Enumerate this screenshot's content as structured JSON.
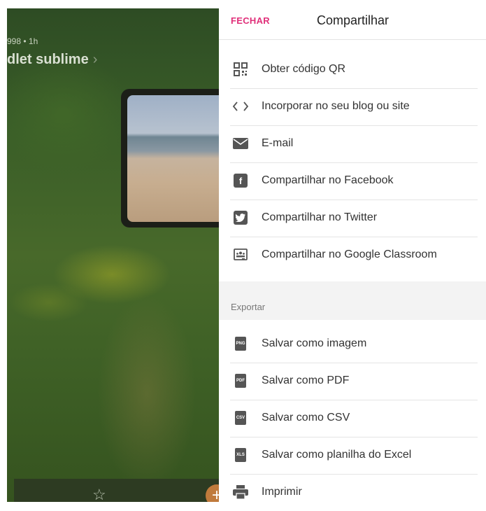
{
  "background": {
    "meta": "998 • 1h",
    "title": "dlet sublime"
  },
  "sheet": {
    "close_label": "FECHAR",
    "title": "Compartilhar",
    "share_items": [
      {
        "label": "Obter código QR",
        "icon": "qr-code-icon"
      },
      {
        "label": "Incorporar no seu blog ou site",
        "icon": "code-icon"
      },
      {
        "label": "E-mail",
        "icon": "envelope-icon"
      },
      {
        "label": "Compartilhar no Facebook",
        "icon": "facebook-icon"
      },
      {
        "label": "Compartilhar no Twitter",
        "icon": "twitter-icon"
      },
      {
        "label": "Compartilhar no Google Classroom",
        "icon": "google-classroom-icon"
      }
    ],
    "export_section_label": "Exportar",
    "export_items": [
      {
        "label": "Salvar como imagem",
        "icon": "png-file-icon",
        "badge": "PNG"
      },
      {
        "label": "Salvar como PDF",
        "icon": "pdf-file-icon",
        "badge": "PDF"
      },
      {
        "label": "Salvar como CSV",
        "icon": "csv-file-icon",
        "badge": "CSV"
      },
      {
        "label": "Salvar como planilha do Excel",
        "icon": "xls-file-icon",
        "badge": "XLS"
      },
      {
        "label": "Imprimir",
        "icon": "printer-icon"
      }
    ]
  },
  "colors": {
    "accent": "#e0307a",
    "fab": "#c07a3c"
  }
}
